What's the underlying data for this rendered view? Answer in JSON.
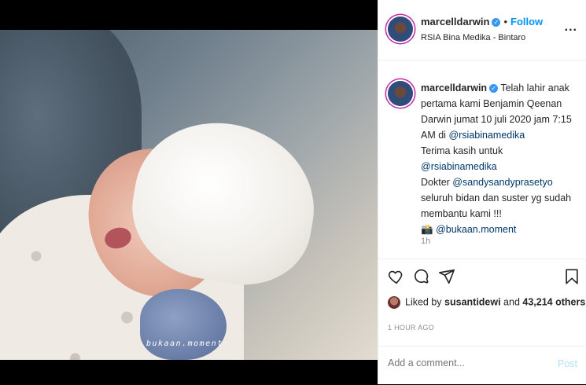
{
  "post": {
    "watermark": "bukaan.moment"
  },
  "header": {
    "username": "marcelldarwin",
    "dot": "•",
    "follow_label": "Follow",
    "location": "RSIA Bina Medika - Bintaro",
    "more_label": "..."
  },
  "caption": {
    "username": "marcelldarwin",
    "line1": "Telah lahir anak pertama kami Benjamin Qeenan Darwin jumat 10 juli 2020 jam 7:15 AM di ",
    "mention1": "@rsiabinamedika",
    "line2": "Terima kasih untuk ",
    "mention2": "@rsiabinamedika",
    "line3": "Dokter ",
    "mention3": "@sandysandyprasetyo",
    "line4": " seluruh bidan dan suster yg sudah membantu kami !!!",
    "camera_emoji": "📸",
    "mention4": "@bukaan.moment",
    "time_ago": "1h"
  },
  "likes": {
    "prefix": "Liked by ",
    "liker": "susantidewi",
    "middle": " and ",
    "count": "43,214 others"
  },
  "posted": "1 HOUR AGO",
  "comment": {
    "placeholder": "Add a comment...",
    "post_label": "Post"
  },
  "icons": [
    "heart-icon",
    "comment-icon",
    "share-icon",
    "bookmark-icon",
    "verified-badge-icon",
    "more-icon"
  ],
  "colors": {
    "accent": "#0095f6",
    "post_disabled": "#b2dffc",
    "mention": "#00376b",
    "verified": "#3897f0"
  }
}
